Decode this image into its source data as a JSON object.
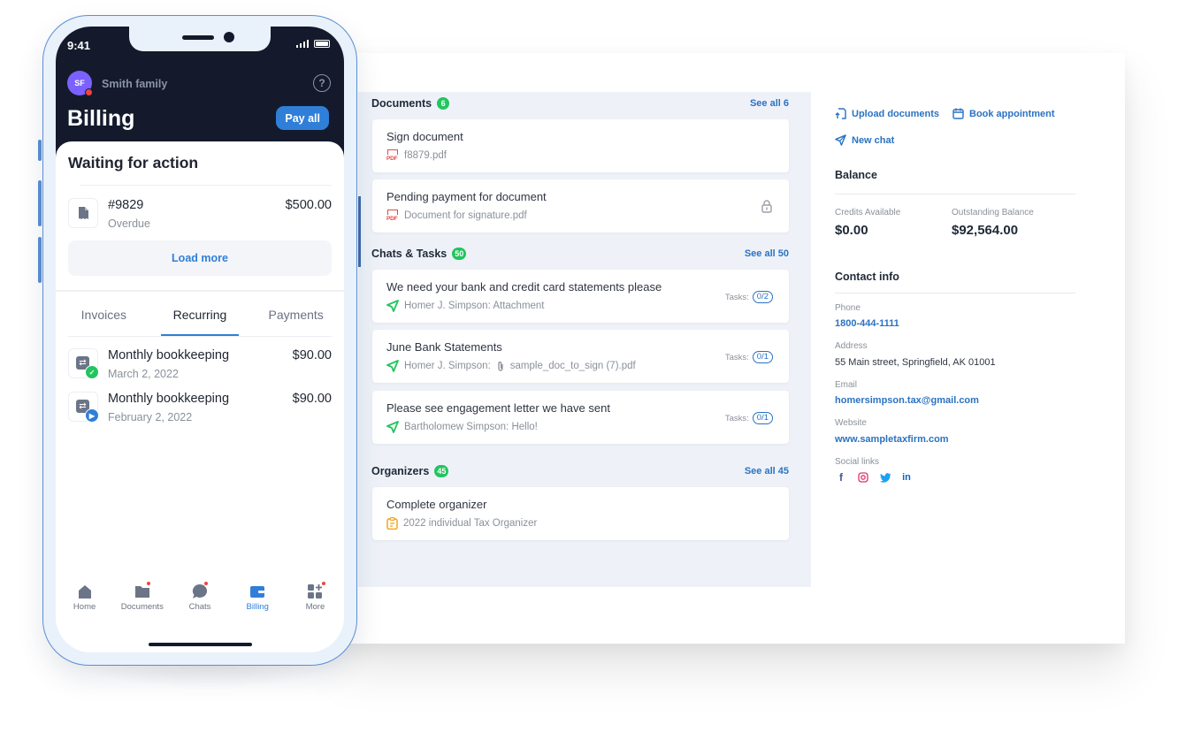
{
  "phone": {
    "status_time": "9:41",
    "avatar_initials": "SF",
    "family_name": "Smith family",
    "help_icon": "question-circle-icon",
    "title": "Billing",
    "pay_all_label": "Pay all",
    "waiting_title": "Waiting for action",
    "waiting_items": [
      {
        "number": "#9829",
        "status": "Overdue",
        "amount": "$500.00",
        "icon": "receipt-icon"
      }
    ],
    "load_more_label": "Load more",
    "tabs": [
      {
        "label": "Invoices",
        "active": false
      },
      {
        "label": "Recurring",
        "active": true
      },
      {
        "label": "Payments",
        "active": false
      }
    ],
    "recurring_items": [
      {
        "title": "Monthly bookkeeping",
        "date": "March 2, 2022",
        "amount": "$90.00",
        "status_icon": "check-circle-icon",
        "status_color": "#22c55e"
      },
      {
        "title": "Monthly bookkeeping",
        "date": "February 2, 2022",
        "amount": "$90.00",
        "status_icon": "play-circle-icon",
        "status_color": "#2f7fd8"
      }
    ],
    "bottom_nav": [
      {
        "label": "Home",
        "icon": "home-icon",
        "active": false,
        "dot": false
      },
      {
        "label": "Documents",
        "icon": "folder-icon",
        "active": false,
        "dot": true
      },
      {
        "label": "Chats",
        "icon": "chat-bubble-icon",
        "active": false,
        "dot": true
      },
      {
        "label": "Billing",
        "icon": "wallet-icon",
        "active": true,
        "dot": false
      },
      {
        "label": "More",
        "icon": "grid-plus-icon",
        "active": false,
        "dot": true
      }
    ]
  },
  "documents": {
    "title": "Documents",
    "count": "6",
    "see_all": "See all 6",
    "items": [
      {
        "title": "Sign document",
        "file": "f8879.pdf",
        "locked": false
      },
      {
        "title": "Pending payment for document",
        "file": "Document for signature.pdf",
        "locked": true
      }
    ]
  },
  "chats": {
    "title": "Chats & Tasks",
    "count": "50",
    "see_all": "See all 50",
    "tasks_label": "Tasks:",
    "items": [
      {
        "title": "We need your bank and credit card statements please",
        "sender": "Homer J. Simpson: Attachment",
        "attachment": "",
        "tasks": "0/2"
      },
      {
        "title": "June Bank Statements",
        "sender": "Homer J. Simpson:",
        "attachment": "sample_doc_to_sign (7).pdf",
        "tasks": "0/1"
      },
      {
        "title": "Please see engagement letter we have sent",
        "sender": "Bartholomew Simpson: Hello!",
        "attachment": "",
        "tasks": "0/1"
      }
    ]
  },
  "organizers": {
    "title": "Organizers",
    "count": "45",
    "see_all": "See all 45",
    "items": [
      {
        "title": "Complete organizer",
        "subtitle": "2022 individual Tax Organizer"
      }
    ]
  },
  "actions": {
    "upload": "Upload documents",
    "book": "Book appointment",
    "new_chat": "New chat"
  },
  "balance": {
    "title": "Balance",
    "credits_label": "Credits Available",
    "credits_value": "$0.00",
    "outstanding_label": "Outstanding Balance",
    "outstanding_value": "$92,564.00"
  },
  "contact": {
    "title": "Contact info",
    "phone_label": "Phone",
    "phone": "1800-444-1111",
    "address_label": "Address",
    "address": "55 Main street, Springfield, AK 01001",
    "email_label": "Email",
    "email": "homersimpson.tax@gmail.com",
    "website_label": "Website",
    "website": "www.sampletaxfirm.com",
    "social_label": "Social links",
    "social": [
      {
        "name": "facebook",
        "glyph": "f",
        "color": "#3b5998"
      },
      {
        "name": "instagram",
        "glyph": "◎",
        "color": "#e1306c"
      },
      {
        "name": "twitter",
        "glyph": "🐦",
        "color": "#1da1f2"
      },
      {
        "name": "linkedin",
        "glyph": "in",
        "color": "#0a66c2"
      }
    ]
  },
  "colors": {
    "accent": "#2f7fd8",
    "link": "#2b72c2",
    "badge_green": "#22c55e",
    "phone_dark": "#141a2c"
  }
}
